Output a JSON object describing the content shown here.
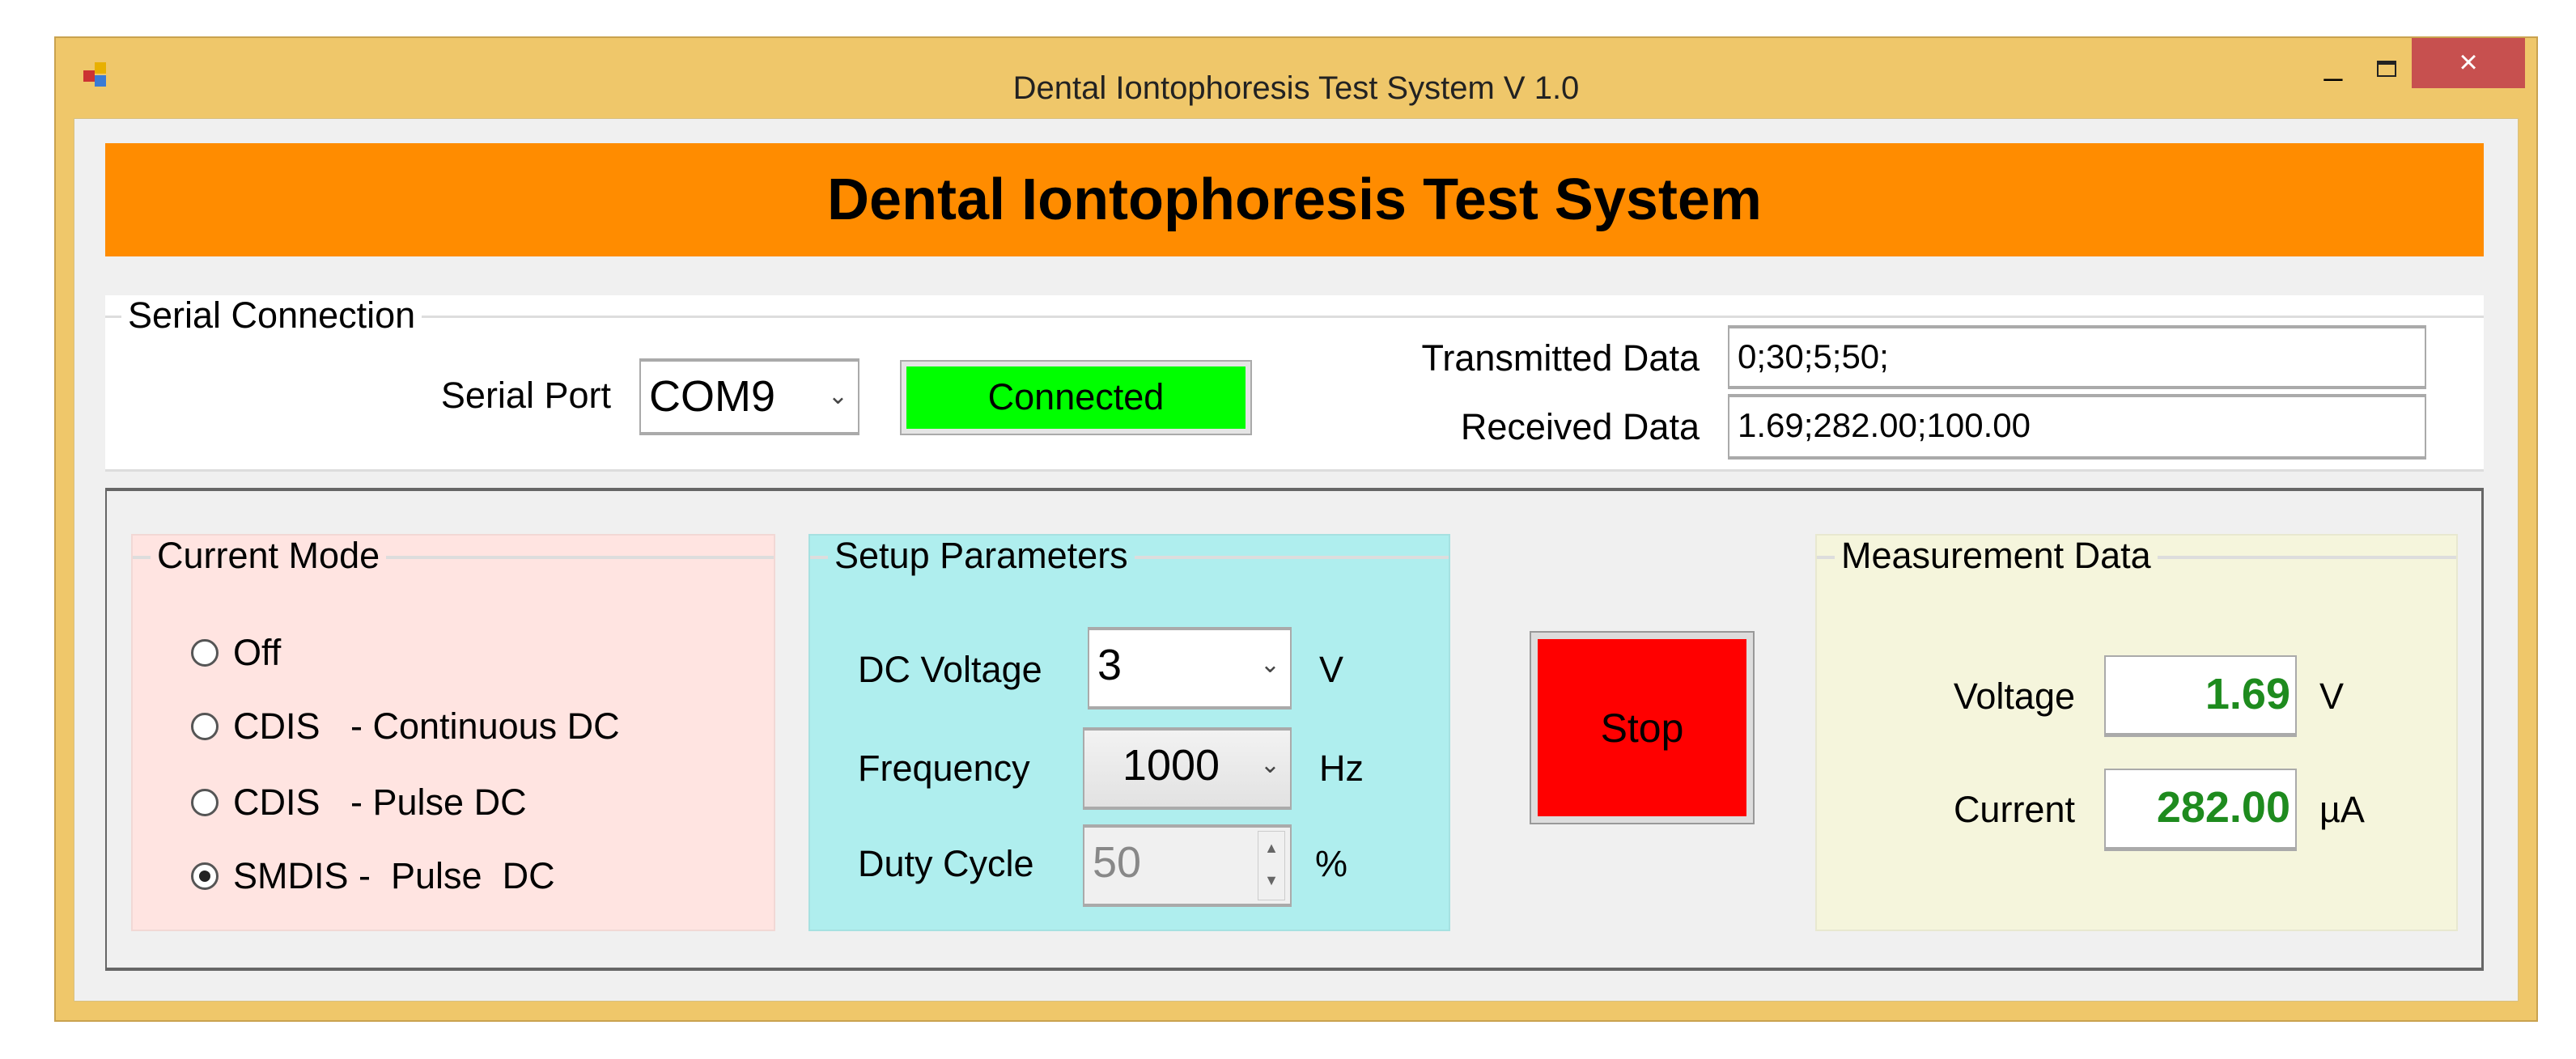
{
  "window": {
    "title": "Dental Iontophoresis Test System   V 1.0",
    "minimize": "_",
    "close": "×"
  },
  "banner": {
    "title": "Dental Iontophoresis Test System"
  },
  "serial": {
    "group_title": "Serial Connection",
    "port_label": "Serial Port",
    "port_value": "COM9",
    "status": "Connected",
    "status_color": "#00FF00",
    "transmitted_label": "Transmitted Data",
    "transmitted_value": "0;30;5;50;",
    "received_label": "Received Data",
    "received_value": "1.69;282.00;100.00"
  },
  "mode": {
    "group_title": "Current Mode",
    "options": [
      {
        "label": "Off",
        "checked": false
      },
      {
        "label": "CDIS   - Continuous DC",
        "checked": false
      },
      {
        "label": "CDIS   - Pulse DC",
        "checked": false
      },
      {
        "label": "SMDIS -  Pulse  DC",
        "checked": true
      }
    ]
  },
  "setup": {
    "group_title": "Setup Parameters",
    "dc_voltage_label": "DC Voltage",
    "dc_voltage_value": "3",
    "dc_voltage_unit": "V",
    "frequency_label": "Frequency",
    "frequency_value": "1000",
    "frequency_unit": "Hz",
    "duty_label": "Duty Cycle",
    "duty_value": "50",
    "duty_unit": "%"
  },
  "stop_button": {
    "label": "Stop",
    "color": "#FF0000"
  },
  "measurement": {
    "group_title": "Measurement Data",
    "voltage_label": "Voltage",
    "voltage_value": "1.69",
    "voltage_unit": "V",
    "current_label": "Current",
    "current_value": "282.00",
    "current_unit": "µA"
  }
}
